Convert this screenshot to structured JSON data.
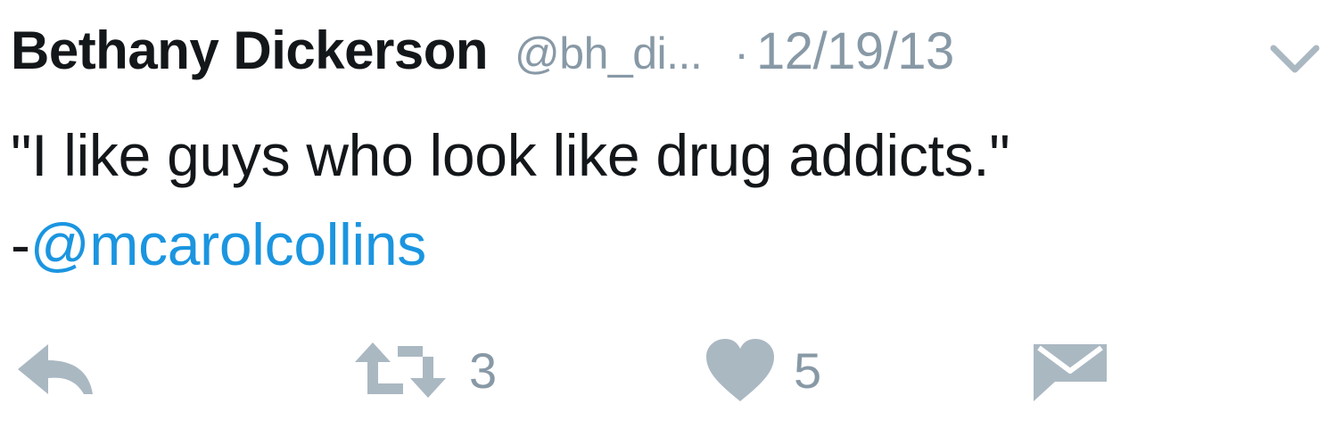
{
  "tweet": {
    "author_name": "Bethany Dickerson",
    "author_handle": "@bh_di...",
    "separator": "·",
    "date": "12/19/13",
    "text_line1": "\"I like guys who look like drug addicts.\"",
    "text_line2_prefix": "-",
    "mention": "@mcarolcollins"
  },
  "actions": {
    "retweet_count": "3",
    "like_count": "5"
  },
  "icons": {
    "caret": "chevron-down-icon",
    "reply": "reply-icon",
    "retweet": "retweet-icon",
    "like": "heart-icon",
    "dm": "envelope-icon"
  },
  "colors": {
    "text": "#14171a",
    "muted": "#8899a6",
    "link": "#1b95e0",
    "icon": "#aab8c2"
  }
}
